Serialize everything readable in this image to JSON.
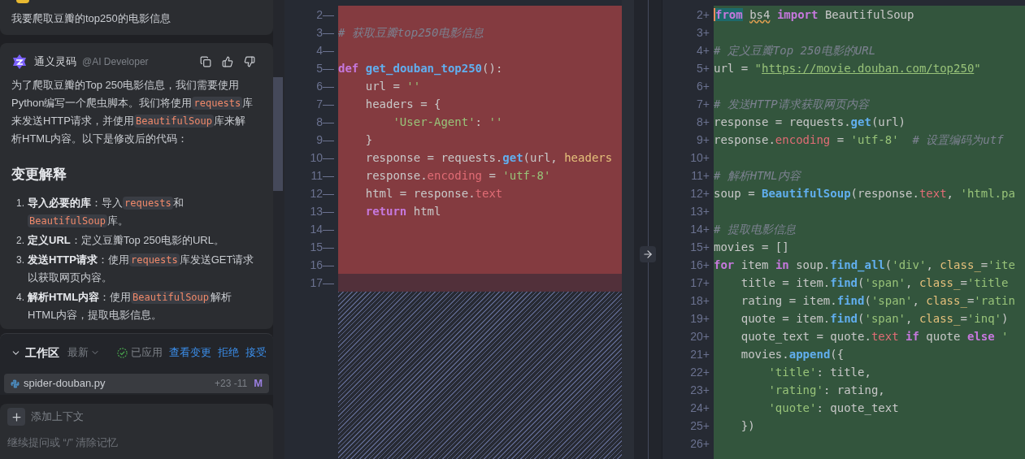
{
  "chat": {
    "user_message": {
      "text": "我要爬取豆瓣的top250的电影信息"
    },
    "ai_message": {
      "author": "通义灵码",
      "handle": "@AI Developer",
      "intro": [
        {
          "kind": "text",
          "text": "为了爬取豆瓣的Top 250电影信息，我们需要使用Python编写一个爬虫脚本。我们将使用"
        },
        {
          "kind": "code",
          "text": "requests"
        },
        {
          "kind": "text",
          "text": "库来发送HTTP请求，并使用"
        },
        {
          "kind": "code",
          "text": "BeautifulSoup"
        },
        {
          "kind": "text",
          "text": "库来解析HTML内容。以下是修改后的代码："
        }
      ],
      "heading": "变更解释",
      "items": [
        {
          "number": "1.",
          "segments": [
            {
              "kind": "bold",
              "text": "导入必要的库"
            },
            {
              "kind": "text",
              "text": "：导入"
            },
            {
              "kind": "code",
              "text": "requests"
            },
            {
              "kind": "text",
              "text": "和"
            },
            {
              "kind": "code",
              "text": "BeautifulSoup"
            },
            {
              "kind": "text",
              "text": "库。"
            }
          ]
        },
        {
          "number": "2.",
          "segments": [
            {
              "kind": "bold",
              "text": "定义URL"
            },
            {
              "kind": "text",
              "text": "：定义豆瓣Top 250电影的URL。"
            }
          ]
        },
        {
          "number": "3.",
          "segments": [
            {
              "kind": "bold",
              "text": "发送HTTP请求"
            },
            {
              "kind": "text",
              "text": "：使用"
            },
            {
              "kind": "code",
              "text": "requests"
            },
            {
              "kind": "text",
              "text": "库发送GET请求以获取网页内容。"
            }
          ]
        },
        {
          "number": "4.",
          "segments": [
            {
              "kind": "bold",
              "text": "解析HTML内容"
            },
            {
              "kind": "text",
              "text": "：使用"
            },
            {
              "kind": "code",
              "text": "BeautifulSoup"
            },
            {
              "kind": "text",
              "text": "解析HTML内容，提取电影信息。"
            }
          ]
        }
      ]
    }
  },
  "workspace": {
    "title": "工作区",
    "expanded": true,
    "filter": "最新",
    "status": "已应用",
    "actions": [
      "查看变更",
      "拒绝",
      "接受"
    ],
    "files": [
      {
        "name": "spider-douban.py",
        "stats": "+23 -11",
        "status": "M"
      }
    ]
  },
  "input": {
    "add_context": "添加上下文",
    "placeholder": "继续提问或 “/” 清除记忆"
  },
  "diff": {
    "left": {
      "lines": [
        {
          "gutter": "2—",
          "kind": "removed"
        },
        {
          "gutter": "3—",
          "kind": "removed",
          "tokens": [
            {
              "kind": "cmt",
              "text": "# 获取豆瓣top250电影信息"
            }
          ]
        },
        {
          "gutter": "4—",
          "kind": "removed"
        },
        {
          "gutter": "5—",
          "kind": "removed",
          "tokens": [
            {
              "kind": "kw",
              "text": "def"
            },
            {
              "kind": "fn",
              "text": " get_douban_top250"
            },
            {
              "kind": "pl",
              "text": "():"
            }
          ]
        },
        {
          "gutter": "6—",
          "kind": "removed",
          "tokens": [
            {
              "kind": "pl",
              "text": "    url = "
            },
            {
              "kind": "str",
              "text": "''"
            }
          ]
        },
        {
          "gutter": "7—",
          "kind": "removed",
          "tokens": [
            {
              "kind": "pl",
              "text": "    headers = {"
            }
          ]
        },
        {
          "gutter": "8—",
          "kind": "removed",
          "tokens": [
            {
              "kind": "str",
              "text": "        'User-Agent'"
            },
            {
              "kind": "pl",
              "text": ": "
            },
            {
              "kind": "str",
              "text": "''"
            }
          ]
        },
        {
          "gutter": "9—",
          "kind": "removed",
          "tokens": [
            {
              "kind": "pl",
              "text": "    }"
            }
          ]
        },
        {
          "gutter": "10—",
          "kind": "removed",
          "tokens": [
            {
              "kind": "pl",
              "text": "    response = requests."
            },
            {
              "kind": "fn",
              "text": "get"
            },
            {
              "kind": "pl",
              "text": "(url, "
            },
            {
              "kind": "param",
              "text": "headers"
            }
          ]
        },
        {
          "gutter": "11—",
          "kind": "removed",
          "tokens": [
            {
              "kind": "pl",
              "text": "    response."
            },
            {
              "kind": "attr",
              "text": "encoding"
            },
            {
              "kind": "pl",
              "text": " = "
            },
            {
              "kind": "str",
              "text": "'utf-8'"
            }
          ]
        },
        {
          "gutter": "12—",
          "kind": "removed",
          "tokens": [
            {
              "kind": "pl",
              "text": "    html = response."
            },
            {
              "kind": "attr",
              "text": "text"
            }
          ]
        },
        {
          "gutter": "13—",
          "kind": "removed",
          "tokens": [
            {
              "kind": "kw",
              "text": "    return"
            },
            {
              "kind": "pl",
              "text": " html"
            }
          ]
        },
        {
          "gutter": "14—",
          "kind": "removed"
        },
        {
          "gutter": "15—",
          "kind": "removed"
        },
        {
          "gutter": "16—",
          "kind": "removed"
        },
        {
          "gutter": "17—",
          "kind": "padding"
        }
      ]
    },
    "right": {
      "lines": [
        {
          "gutter": "2+",
          "kind": "added",
          "tokens": [
            {
              "kind": "kwm",
              "text": "from"
            },
            {
              "kind": "typo",
              "text": " bs4"
            },
            {
              "kind": "kw",
              "text": " import"
            },
            {
              "kind": "pl",
              "text": " BeautifulSoup"
            }
          ]
        },
        {
          "gutter": "3+",
          "kind": "added"
        },
        {
          "gutter": "4+",
          "kind": "added",
          "tokens": [
            {
              "kind": "cmt",
              "text": "# 定义豆瓣Top 250电影的URL"
            }
          ]
        },
        {
          "gutter": "5+",
          "kind": "added",
          "tokens": [
            {
              "kind": "pl",
              "text": "url = "
            },
            {
              "kind": "str",
              "text": "\""
            },
            {
              "kind": "url",
              "text": "https://movie.douban.com/top250"
            },
            {
              "kind": "str",
              "text": "\""
            }
          ]
        },
        {
          "gutter": "6+",
          "kind": "added"
        },
        {
          "gutter": "7+",
          "kind": "added",
          "tokens": [
            {
              "kind": "cmt",
              "text": "# 发送HTTP请求获取网页内容"
            }
          ]
        },
        {
          "gutter": "8+",
          "kind": "added",
          "tokens": [
            {
              "kind": "pl",
              "text": "response = requests."
            },
            {
              "kind": "fn",
              "text": "get"
            },
            {
              "kind": "pl",
              "text": "(url)"
            }
          ]
        },
        {
          "gutter": "9+",
          "kind": "added",
          "tokens": [
            {
              "kind": "pl",
              "text": "response."
            },
            {
              "kind": "attr",
              "text": "encoding"
            },
            {
              "kind": "pl",
              "text": " = "
            },
            {
              "kind": "str",
              "text": "'utf-8'"
            },
            {
              "kind": "cmt",
              "text": "  # 设置编码为utf"
            }
          ]
        },
        {
          "gutter": "10+",
          "kind": "added"
        },
        {
          "gutter": "11+",
          "kind": "added",
          "tokens": [
            {
              "kind": "cmt",
              "text": "# 解析HTML内容"
            }
          ]
        },
        {
          "gutter": "12+",
          "kind": "added",
          "tokens": [
            {
              "kind": "pl",
              "text": "soup = "
            },
            {
              "kind": "fn",
              "text": "BeautifulSoup"
            },
            {
              "kind": "pl",
              "text": "(response."
            },
            {
              "kind": "attr",
              "text": "text"
            },
            {
              "kind": "pl",
              "text": ", "
            },
            {
              "kind": "str",
              "text": "'html.pa"
            }
          ]
        },
        {
          "gutter": "13+",
          "kind": "added"
        },
        {
          "gutter": "14+",
          "kind": "added",
          "tokens": [
            {
              "kind": "cmt",
              "text": "# 提取电影信息"
            }
          ]
        },
        {
          "gutter": "15+",
          "kind": "added",
          "tokens": [
            {
              "kind": "pl",
              "text": "movies = []"
            }
          ]
        },
        {
          "gutter": "16+",
          "kind": "added",
          "tokens": [
            {
              "kind": "kw",
              "text": "for"
            },
            {
              "kind": "pl",
              "text": " item "
            },
            {
              "kind": "kw",
              "text": "in"
            },
            {
              "kind": "pl",
              "text": " soup."
            },
            {
              "kind": "fn",
              "text": "find_all"
            },
            {
              "kind": "pl",
              "text": "("
            },
            {
              "kind": "str",
              "text": "'div'"
            },
            {
              "kind": "pl",
              "text": ", "
            },
            {
              "kind": "param",
              "text": "class_"
            },
            {
              "kind": "pl",
              "text": "="
            },
            {
              "kind": "str",
              "text": "'ite"
            }
          ]
        },
        {
          "gutter": "17+",
          "kind": "added",
          "tokens": [
            {
              "kind": "pl",
              "text": "    title = item."
            },
            {
              "kind": "fn",
              "text": "find"
            },
            {
              "kind": "pl",
              "text": "("
            },
            {
              "kind": "str",
              "text": "'span'"
            },
            {
              "kind": "pl",
              "text": ", "
            },
            {
              "kind": "param",
              "text": "class_"
            },
            {
              "kind": "pl",
              "text": "="
            },
            {
              "kind": "str",
              "text": "'title"
            }
          ]
        },
        {
          "gutter": "18+",
          "kind": "added",
          "tokens": [
            {
              "kind": "pl",
              "text": "    rating = item."
            },
            {
              "kind": "fn",
              "text": "find"
            },
            {
              "kind": "pl",
              "text": "("
            },
            {
              "kind": "str",
              "text": "'span'"
            },
            {
              "kind": "pl",
              "text": ", "
            },
            {
              "kind": "param",
              "text": "class_"
            },
            {
              "kind": "pl",
              "text": "="
            },
            {
              "kind": "str",
              "text": "'ratin"
            }
          ]
        },
        {
          "gutter": "19+",
          "kind": "added",
          "tokens": [
            {
              "kind": "pl",
              "text": "    quote = item."
            },
            {
              "kind": "fn",
              "text": "find"
            },
            {
              "kind": "pl",
              "text": "("
            },
            {
              "kind": "str",
              "text": "'span'"
            },
            {
              "kind": "pl",
              "text": ", "
            },
            {
              "kind": "param",
              "text": "class_"
            },
            {
              "kind": "pl",
              "text": "="
            },
            {
              "kind": "str",
              "text": "'inq'"
            },
            {
              "kind": "pl",
              "text": ")"
            }
          ]
        },
        {
          "gutter": "20+",
          "kind": "added",
          "tokens": [
            {
              "kind": "pl",
              "text": "    quote_text = quote."
            },
            {
              "kind": "attr",
              "text": "text"
            },
            {
              "kind": "kw",
              "text": " if"
            },
            {
              "kind": "pl",
              "text": " quote "
            },
            {
              "kind": "kw",
              "text": "else"
            },
            {
              "kind": "str",
              "text": " '"
            }
          ]
        },
        {
          "gutter": "21+",
          "kind": "added",
          "tokens": [
            {
              "kind": "pl",
              "text": "    movies."
            },
            {
              "kind": "fn",
              "text": "append"
            },
            {
              "kind": "pl",
              "text": "({"
            }
          ]
        },
        {
          "gutter": "22+",
          "kind": "added",
          "tokens": [
            {
              "kind": "str",
              "text": "        'title'"
            },
            {
              "kind": "pl",
              "text": ": title,"
            }
          ]
        },
        {
          "gutter": "23+",
          "kind": "added",
          "tokens": [
            {
              "kind": "str",
              "text": "        'rating'"
            },
            {
              "kind": "pl",
              "text": ": rating,"
            }
          ]
        },
        {
          "gutter": "24+",
          "kind": "added",
          "tokens": [
            {
              "kind": "str",
              "text": "        'quote'"
            },
            {
              "kind": "pl",
              "text": ": quote_text"
            }
          ]
        },
        {
          "gutter": "25+",
          "kind": "added",
          "tokens": [
            {
              "kind": "pl",
              "text": "    })"
            }
          ]
        },
        {
          "gutter": "26+",
          "kind": "added"
        }
      ]
    }
  }
}
